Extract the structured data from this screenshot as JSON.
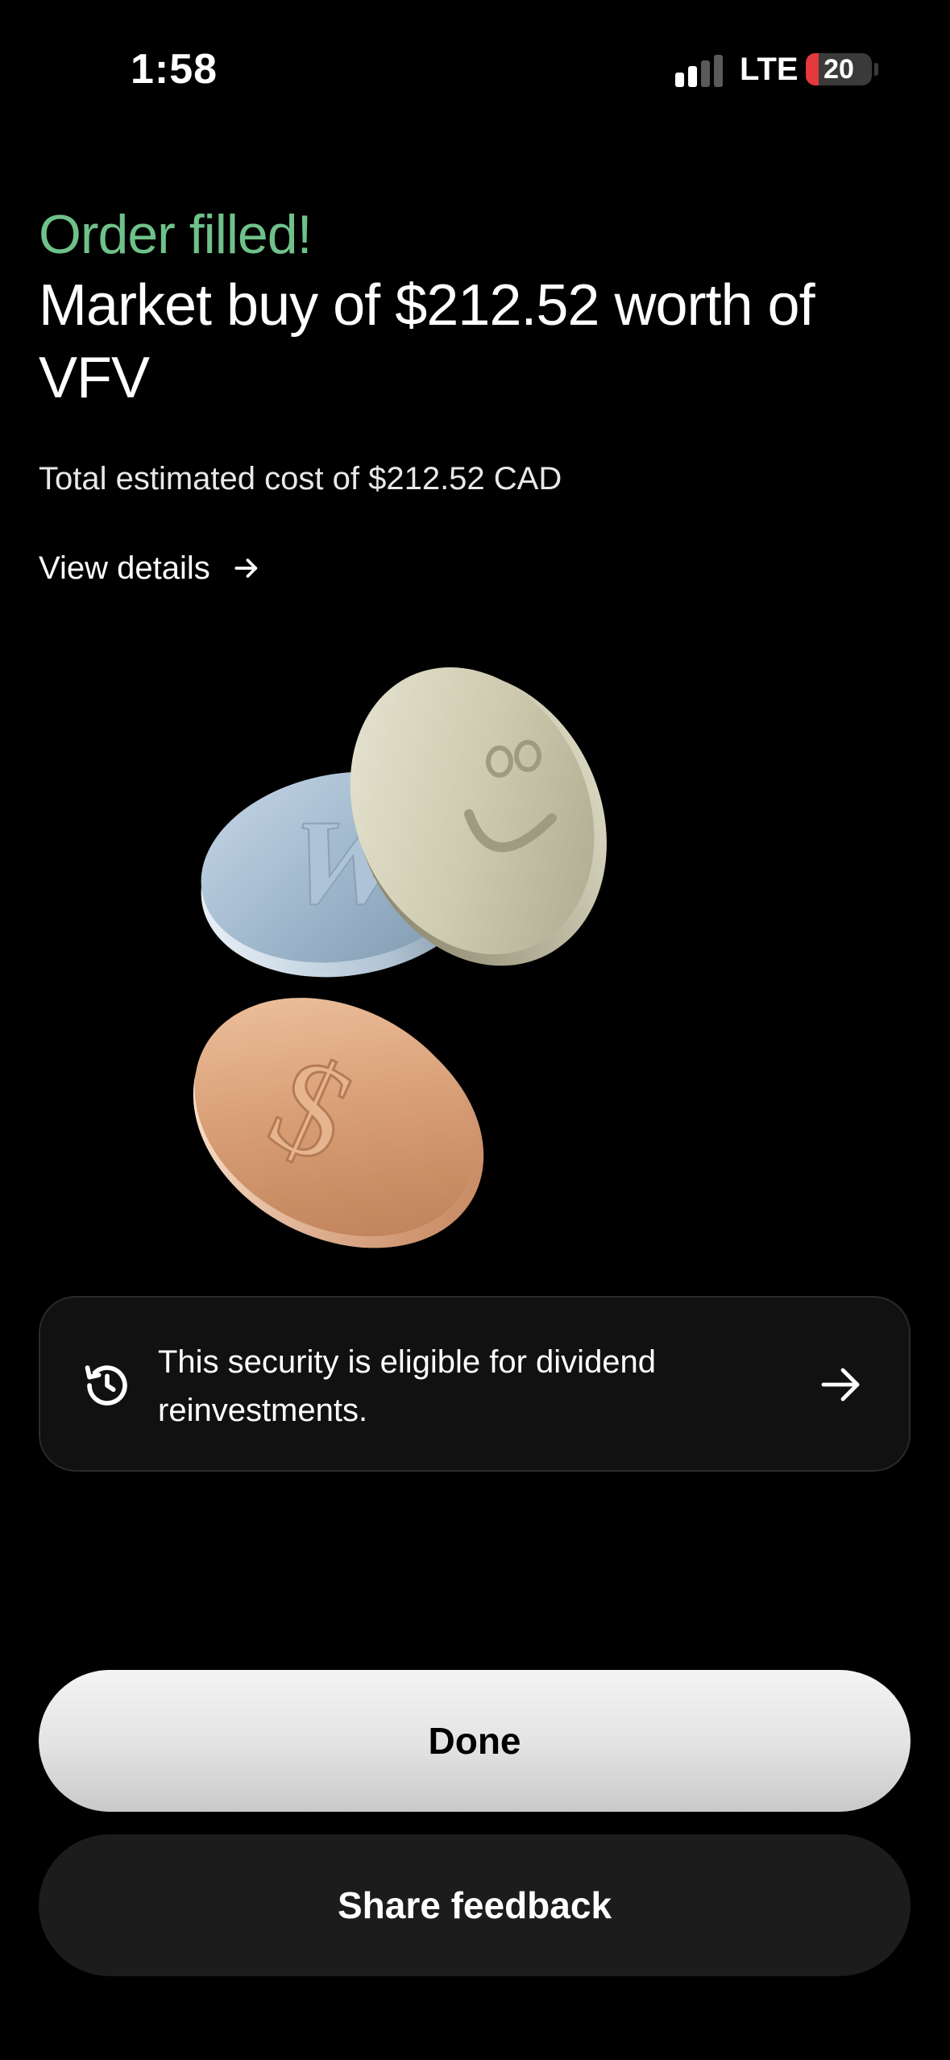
{
  "status_bar": {
    "time": "1:58",
    "network": "LTE",
    "battery_level": "20",
    "battery_fraction": 0.2,
    "signal_bars_active": 2,
    "signal_bars_total": 4
  },
  "order": {
    "status": "Order filled!",
    "title": "Market buy of $212.52 worth of VFV",
    "total_cost": "Total estimated cost of $212.52 CAD",
    "view_details_label": "View details"
  },
  "dividend_card": {
    "text": "This security is eligible for dividend reinvestments."
  },
  "buttons": {
    "done_label": "Done",
    "feedback_label": "Share feedback"
  },
  "colors": {
    "accent_green": "#6fc18a",
    "background": "#000000",
    "card_background": "#111111",
    "battery_low": "#e5383b"
  },
  "icons": {
    "view_details": "arrow-right-icon",
    "dividend": "history-icon",
    "card_action": "arrow-right-icon"
  }
}
